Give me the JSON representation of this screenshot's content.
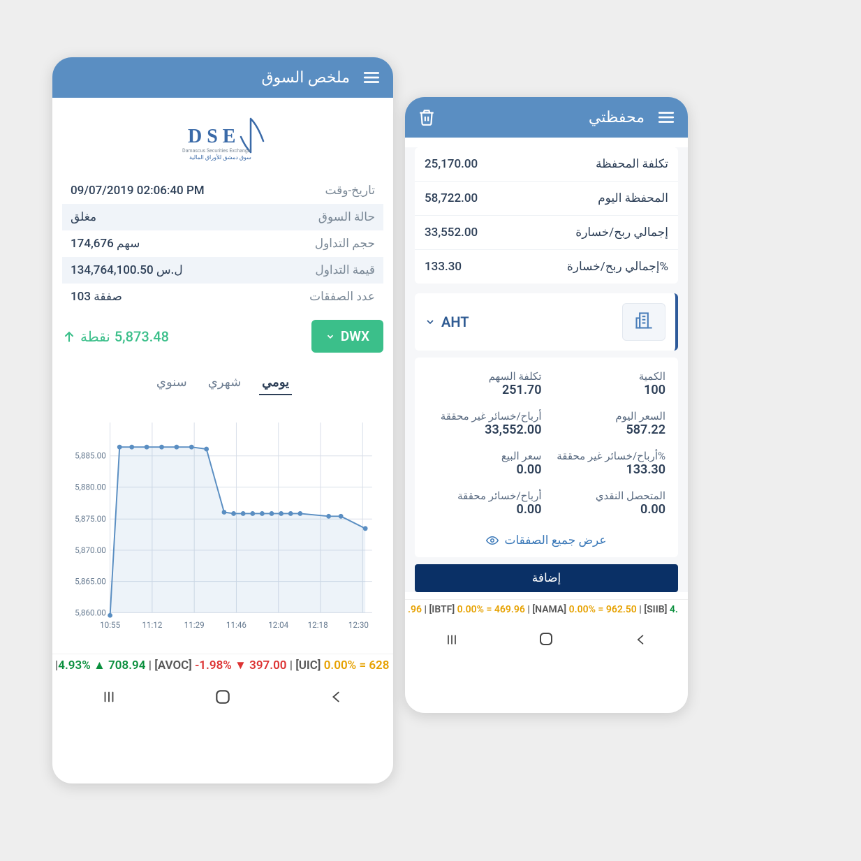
{
  "left": {
    "title": "ملخص السوق",
    "logo_text": "DSE",
    "logo_sub": "Damascus Securities Exchange",
    "logo_ar": "سوق دمشق للأوراق المالية",
    "info": [
      {
        "label": "تاريخ-وقت",
        "value": "09/07/2019 02:06:40 PM"
      },
      {
        "label": "حالة السوق",
        "value": "مغلق",
        "closed": true
      },
      {
        "label": "حجم التداول",
        "value": "174,676 سهم"
      },
      {
        "label": "قيمة التداول",
        "value": "134,764,100.50 ل.س"
      },
      {
        "label": "عدد الصفقات",
        "value": "103 صفقة"
      }
    ],
    "dwx_label": "DWX",
    "points": "5,873.48",
    "points_unit": "نقطة",
    "tabs": {
      "daily": "يومي",
      "monthly": "شهري",
      "yearly": "سنوي"
    },
    "ticker": {
      "t1_pct": "4.93%",
      "t1_val": "708.94",
      "t2_sym": "[AVOC]",
      "t2_pct": "-1.98%",
      "t2_val": "397.00",
      "t3_sym": "[UIC]",
      "t3_pct": "0.00%",
      "t3_eq": "= 628"
    }
  },
  "right": {
    "title": "محفظتي",
    "portfolio": [
      {
        "label": "تكلفة المحفظة",
        "value": "25,170.00"
      },
      {
        "label": "المحفظة اليوم",
        "value": "58,722.00"
      },
      {
        "label": "إجمالي ربح/خسارة",
        "value": "33,552.00"
      },
      {
        "label": "إجمالي ربح/خسارة%",
        "value": "133.30"
      }
    ],
    "aht": "AHT",
    "details": [
      [
        {
          "label": "الكمية",
          "value": "100"
        },
        {
          "label": "تكلفة السهم",
          "value": "251.70"
        }
      ],
      [
        {
          "label": "السعر اليوم",
          "value": "587.22"
        },
        {
          "label": "أرباح/خسائر غير محققة",
          "value": "33,552.00"
        }
      ],
      [
        {
          "label": "أرباح/خسائر غير محققة%",
          "value": "133.30"
        },
        {
          "label": "سعر البيع",
          "value": "0.00"
        }
      ],
      [
        {
          "label": "المتحصل النقدي",
          "value": "0.00"
        },
        {
          "label": "أرباح/خسائر محققة",
          "value": "0.00"
        }
      ]
    ],
    "view_deals": "عرض جميع الصفقات",
    "add": "إضافة",
    "ticker": {
      "t1_val": ".96",
      "t2_sym": "[IBTF]",
      "t2_pct": "0.00%",
      "t2_val": "= 469.96",
      "t3_sym": "[NAMA]",
      "t3_pct": "0.00%",
      "t3_val": "= 962.50",
      "t4_sym": "[SIIB]",
      "t4_val": "4."
    }
  },
  "chart_data": {
    "type": "line",
    "title": "",
    "xlabel": "",
    "ylabel": "",
    "ylim": [
      5855,
      5890
    ],
    "x_ticks": [
      "10:55",
      "11:12",
      "11:29",
      "11:46",
      "12:04",
      "12:18",
      "12:30"
    ],
    "y_ticks": [
      5860.0,
      5865.0,
      5870.0,
      5875.0,
      5880.0,
      5885.0
    ],
    "series": [
      {
        "name": "DWX",
        "x": [
          "10:55",
          "10:58",
          "11:02",
          "11:08",
          "11:14",
          "11:20",
          "11:26",
          "11:32",
          "11:40",
          "11:44",
          "11:48",
          "11:52",
          "11:56",
          "12:00",
          "12:04",
          "12:08",
          "12:12",
          "12:22",
          "12:26",
          "12:30"
        ],
        "values": [
          5859.5,
          5886.5,
          5886.5,
          5886.5,
          5886.5,
          5886.5,
          5886.5,
          5886.2,
          5876.2,
          5876.0,
          5876.0,
          5876.0,
          5876.0,
          5876.0,
          5876.0,
          5876.0,
          5876.0,
          5875.5,
          5875.5,
          5873.5
        ]
      }
    ]
  }
}
